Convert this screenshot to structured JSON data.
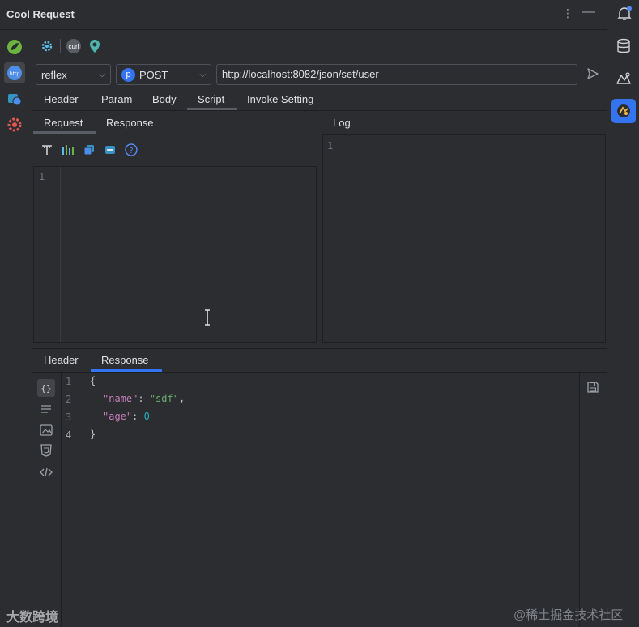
{
  "window": {
    "title": "Cool Request"
  },
  "toolbar_icons": [
    "gear-icon",
    "curl-icon",
    "location-pin-icon"
  ],
  "toolbar_curl_label": "curl",
  "request": {
    "mode": "reflex",
    "method_badge": "p",
    "method": "POST",
    "url": "http://localhost:8082/json/set/user"
  },
  "top_tabs": [
    {
      "label": "Header"
    },
    {
      "label": "Param"
    },
    {
      "label": "Body"
    },
    {
      "label": "Script",
      "selected": true
    },
    {
      "label": "Invoke Setting"
    }
  ],
  "script_tabs": [
    {
      "label": "Request",
      "selected": true
    },
    {
      "label": "Response"
    }
  ],
  "log": {
    "label": "Log",
    "line": "1"
  },
  "script_editor": {
    "line": "1"
  },
  "response_tabs": [
    {
      "label": "Header"
    },
    {
      "label": "Response",
      "selected": true
    }
  ],
  "response_body": {
    "lines": [
      "1",
      "2",
      "3",
      "4"
    ],
    "open_brace": "{",
    "close_brace": "}",
    "name_key": "\"name\"",
    "name_value": "\"sdf\"",
    "age_key": "\"age\"",
    "age_value": "0",
    "colon": ": ",
    "comma": ","
  },
  "icon_label_http": "http",
  "watermarks": {
    "left": "大数跨境",
    "right": "@稀土掘金技术社区"
  },
  "colors": {
    "accent": "#3574f0",
    "background": "#2b2d30",
    "json_key": "#c77dbb",
    "json_string": "#6aab73",
    "json_number": "#2aacb8"
  }
}
